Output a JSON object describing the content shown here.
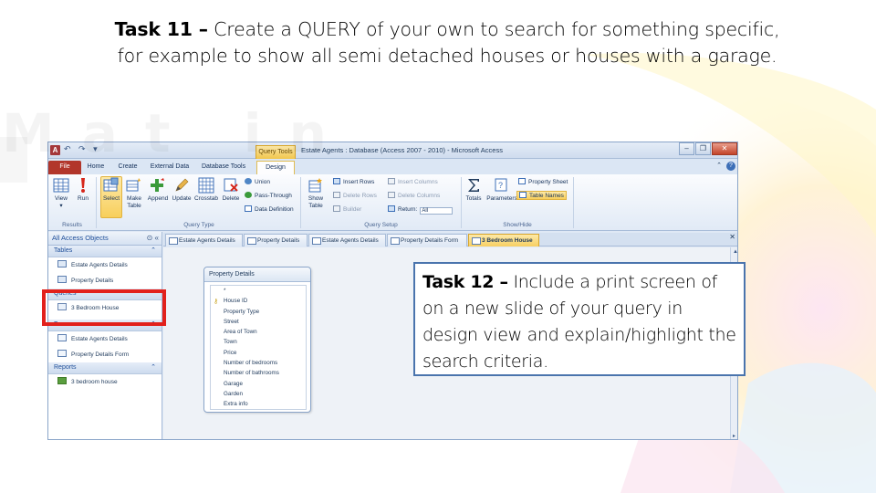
{
  "slide": {
    "task11_head": "Task 11 –",
    "task11_text": " Create a QUERY of your own to search for something specific, for example to show all semi detached houses or houses with a garage.",
    "task12_head": "Task 12 –",
    "task12_text": " Include a print screen of on a new slide of your query in design view and explain/highlight the search criteria.",
    "watermark_text": "Mat in",
    "colors": {
      "highlight_border": "#e2211c",
      "task_box_border": "#4a74ad"
    }
  },
  "window": {
    "app_icon": "A",
    "quick_access": "↶ ↷ ▾",
    "context_tab": "Query Tools",
    "title": "Estate Agents : Database (Access 2007 - 2010) - Microsoft Access",
    "buttons": {
      "minimize": "–",
      "restore": "❐",
      "close": "✕"
    }
  },
  "ribbon_tabs": {
    "file": "File",
    "home": "Home",
    "create": "Create",
    "external": "External Data",
    "tools": "Database Tools",
    "design": "Design"
  },
  "ribbon": {
    "view": "View",
    "run": "Run",
    "select": "Select",
    "make_table": "Make Table",
    "append": "Append",
    "update": "Update",
    "crosstab": "Crosstab",
    "delete": "Delete",
    "union": "Union",
    "pass_through": "Pass-Through",
    "data_definition": "Data Definition",
    "show_table": "Show Table",
    "insert_rows": "Insert Rows",
    "delete_rows": "Delete Rows",
    "builder": "Builder",
    "insert_columns": "Insert Columns",
    "delete_columns": "Delete Columns",
    "return_label": "Return:",
    "return_value": "All",
    "totals": "Totals",
    "parameters": "Parameters",
    "property_sheet": "Property Sheet",
    "table_names": "Table Names",
    "group_results": "Results",
    "group_query_type": "Query Type",
    "group_query_setup": "Query Setup",
    "group_show_hide": "Show/Hide"
  },
  "nav": {
    "header": "All Access Objects",
    "groups": {
      "tables": "Tables",
      "queries": "Queries",
      "forms": "Forms",
      "reports": "Reports"
    },
    "items": {
      "estate_agents_details": "Estate Agents Details",
      "property_details": "Property Details",
      "three_bedroom_house": "3 Bedroom House",
      "estate_agents_details_form": "Estate Agents Details",
      "property_details_form": "Property Details Form",
      "three_bedroom_report": "3 bedroom house"
    }
  },
  "doc_tabs": [
    "Estate Agents Details",
    "Property Details",
    "Estate Agents Details",
    "Property Details Form",
    "3 Bedroom House"
  ],
  "field_list": {
    "title": "Property Details",
    "fields": [
      "*",
      "House ID",
      "Property Type",
      "Street",
      "Area of Town",
      "Town",
      "Price",
      "Number of bedrooms",
      "Number of bathrooms",
      "Garage",
      "Garden",
      "Extra info"
    ]
  }
}
